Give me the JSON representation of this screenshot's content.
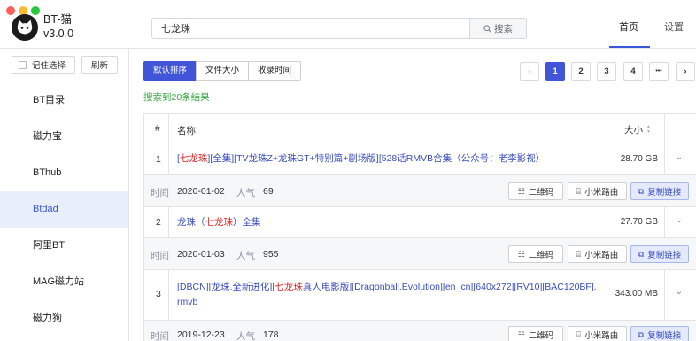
{
  "app": {
    "name": "BT-猫",
    "version": "v3.0.0"
  },
  "search": {
    "query": "七龙珠",
    "button_label": "搜索"
  },
  "nav": {
    "home": "首页",
    "settings": "设置"
  },
  "sidebar": {
    "remember_label": "记住选择",
    "refresh_label": "刷新",
    "items": [
      {
        "label": "BT目录"
      },
      {
        "label": "磁力宝"
      },
      {
        "label": "BThub"
      },
      {
        "label": "Btdad"
      },
      {
        "label": "阿里BT"
      },
      {
        "label": "MAG磁力站"
      },
      {
        "label": "磁力狗"
      }
    ],
    "active_index": 3
  },
  "sort": {
    "options": [
      "默认排序",
      "文件大小",
      "收录时间"
    ],
    "active_index": 0
  },
  "pagination": {
    "prev": "‹",
    "pages": [
      "1",
      "2",
      "3",
      "4"
    ],
    "ellipsis": "•••",
    "next": "›",
    "current": "1"
  },
  "result_count": "搜索到20条结果",
  "table": {
    "headers": {
      "num": "#",
      "name": "名称",
      "size": "大小"
    },
    "rows": [
      {
        "num": "1",
        "title_parts": [
          "[",
          "七龙珠",
          "][全集][TV龙珠Z+龙珠GT+特别篇+剧场版][528话RMVB合集（公众号：老李影视）"
        ],
        "size": "28.70 GB",
        "time_label": "时间",
        "time": "2020-01-02",
        "pop_label": "人气",
        "pop": "69"
      },
      {
        "num": "2",
        "title_parts": [
          "龙珠（",
          "七龙珠",
          "）全集"
        ],
        "size": "27.70 GB",
        "time_label": "时间",
        "time": "2020-01-03",
        "pop_label": "人气",
        "pop": "955"
      },
      {
        "num": "3",
        "title_parts": [
          "[DBCN][龙珠.全新进化][",
          "七龙珠",
          "真人电影版][Dragonball.Evolution][en_cn][640x272][RV10][BAC120BF].rmvb"
        ],
        "size": "343.00 MB",
        "time_label": "时间",
        "time": "2019-12-23",
        "pop_label": "人气",
        "pop": "178"
      }
    ],
    "actions": {
      "qrcode": "二维码",
      "router": "小米路由",
      "copy": "复制链接"
    }
  },
  "colors": {
    "accent": "#4155d8",
    "highlight": "#e02828",
    "success": "#3aa544",
    "link": "#3a4ec0"
  }
}
